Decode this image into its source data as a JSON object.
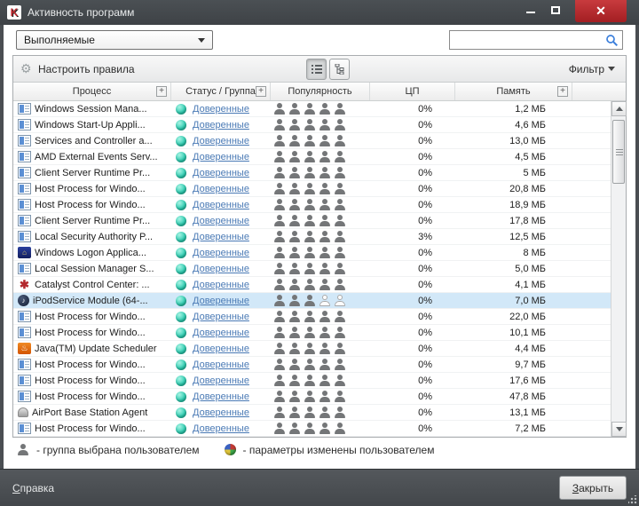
{
  "window": {
    "title": "Активность программ"
  },
  "filter_bar": {
    "view_select_value": "Выполняемые",
    "search_placeholder": ""
  },
  "toolbar": {
    "configure_rules_label": "Настроить правила",
    "filter_label": "Фильтр"
  },
  "table": {
    "headers": {
      "process": "Процесс",
      "status": "Статус / Группа",
      "popularity": "Популярность",
      "cpu": "ЦП",
      "memory": "Память"
    },
    "status_link": "Доверенные",
    "rows": [
      {
        "name": "Windows Session Mana...",
        "icon": "window-app",
        "cpu": "0%",
        "memory": "1,2 МБ",
        "popularity_filled": 5,
        "popularity_total": 5,
        "selected": false
      },
      {
        "name": "Windows Start-Up Appli...",
        "icon": "window-app",
        "cpu": "0%",
        "memory": "4,6 МБ",
        "popularity_filled": 5,
        "popularity_total": 5,
        "selected": false
      },
      {
        "name": "Services and Controller a...",
        "icon": "window-app",
        "cpu": "0%",
        "memory": "13,0 МБ",
        "popularity_filled": 5,
        "popularity_total": 5,
        "selected": false
      },
      {
        "name": "AMD External Events Serv...",
        "icon": "window-app",
        "cpu": "0%",
        "memory": "4,5 МБ",
        "popularity_filled": 5,
        "popularity_total": 5,
        "selected": false
      },
      {
        "name": "Client Server Runtime Pr...",
        "icon": "window-app",
        "cpu": "0%",
        "memory": "5 МБ",
        "popularity_filled": 5,
        "popularity_total": 5,
        "selected": false
      },
      {
        "name": "Host Process for Windo...",
        "icon": "window-app",
        "cpu": "0%",
        "memory": "20,8 МБ",
        "popularity_filled": 5,
        "popularity_total": 5,
        "selected": false
      },
      {
        "name": "Host Process for Windo...",
        "icon": "window-app",
        "cpu": "0%",
        "memory": "18,9 МБ",
        "popularity_filled": 5,
        "popularity_total": 5,
        "selected": false
      },
      {
        "name": "Client Server Runtime Pr...",
        "icon": "window-app",
        "cpu": "0%",
        "memory": "17,8 МБ",
        "popularity_filled": 5,
        "popularity_total": 5,
        "selected": false
      },
      {
        "name": "Local Security Authority P...",
        "icon": "window-app",
        "cpu": "3%",
        "memory": "12,5 МБ",
        "popularity_filled": 5,
        "popularity_total": 5,
        "selected": false
      },
      {
        "name": "Windows Logon Applica...",
        "icon": "logon",
        "cpu": "0%",
        "memory": "8 МБ",
        "popularity_filled": 5,
        "popularity_total": 5,
        "selected": false
      },
      {
        "name": "Local Session Manager S...",
        "icon": "window-app",
        "cpu": "0%",
        "memory": "5,0 МБ",
        "popularity_filled": 5,
        "popularity_total": 5,
        "selected": false
      },
      {
        "name": "Catalyst Control Center: ...",
        "icon": "catalyst",
        "cpu": "0%",
        "memory": "4,1 МБ",
        "popularity_filled": 5,
        "popularity_total": 5,
        "selected": false
      },
      {
        "name": "iPodService Module (64-...",
        "icon": "ipod",
        "cpu": "0%",
        "memory": "7,0 МБ",
        "popularity_filled": 3,
        "popularity_total": 5,
        "selected": true
      },
      {
        "name": "Host Process for Windo...",
        "icon": "window-app",
        "cpu": "0%",
        "memory": "22,0 МБ",
        "popularity_filled": 5,
        "popularity_total": 5,
        "selected": false
      },
      {
        "name": "Host Process for Windo...",
        "icon": "window-app",
        "cpu": "0%",
        "memory": "10,1 МБ",
        "popularity_filled": 5,
        "popularity_total": 5,
        "selected": false
      },
      {
        "name": "Java(TM) Update Scheduler",
        "icon": "java",
        "cpu": "0%",
        "memory": "4,4 МБ",
        "popularity_filled": 5,
        "popularity_total": 5,
        "selected": false
      },
      {
        "name": "Host Process for Windo...",
        "icon": "window-app",
        "cpu": "0%",
        "memory": "9,7 МБ",
        "popularity_filled": 5,
        "popularity_total": 5,
        "selected": false
      },
      {
        "name": "Host Process for Windo...",
        "icon": "window-app",
        "cpu": "0%",
        "memory": "17,6 МБ",
        "popularity_filled": 5,
        "popularity_total": 5,
        "selected": false
      },
      {
        "name": "Host Process for Windo...",
        "icon": "window-app",
        "cpu": "0%",
        "memory": "47,8 МБ",
        "popularity_filled": 5,
        "popularity_total": 5,
        "selected": false
      },
      {
        "name": "AirPort Base Station Agent",
        "icon": "airport",
        "cpu": "0%",
        "memory": "13,1 МБ",
        "popularity_filled": 5,
        "popularity_total": 5,
        "selected": false
      },
      {
        "name": "Host Process for Windo...",
        "icon": "window-app",
        "cpu": "0%",
        "memory": "7,2 МБ",
        "popularity_filled": 5,
        "popularity_total": 5,
        "selected": false
      }
    ]
  },
  "legend": {
    "group_selected": "- группа выбрана пользователем",
    "settings_changed": "- параметры изменены пользователем"
  },
  "footer": {
    "help_label": "Справка",
    "close_label": "Закрыть"
  },
  "colors": {
    "titlebar": "#43474b",
    "close_button_red": "#b02a2e",
    "selection_blue": "#d2e8f8",
    "status_link_blue": "#4a7ab5",
    "orb_teal": "#35cfb4"
  }
}
